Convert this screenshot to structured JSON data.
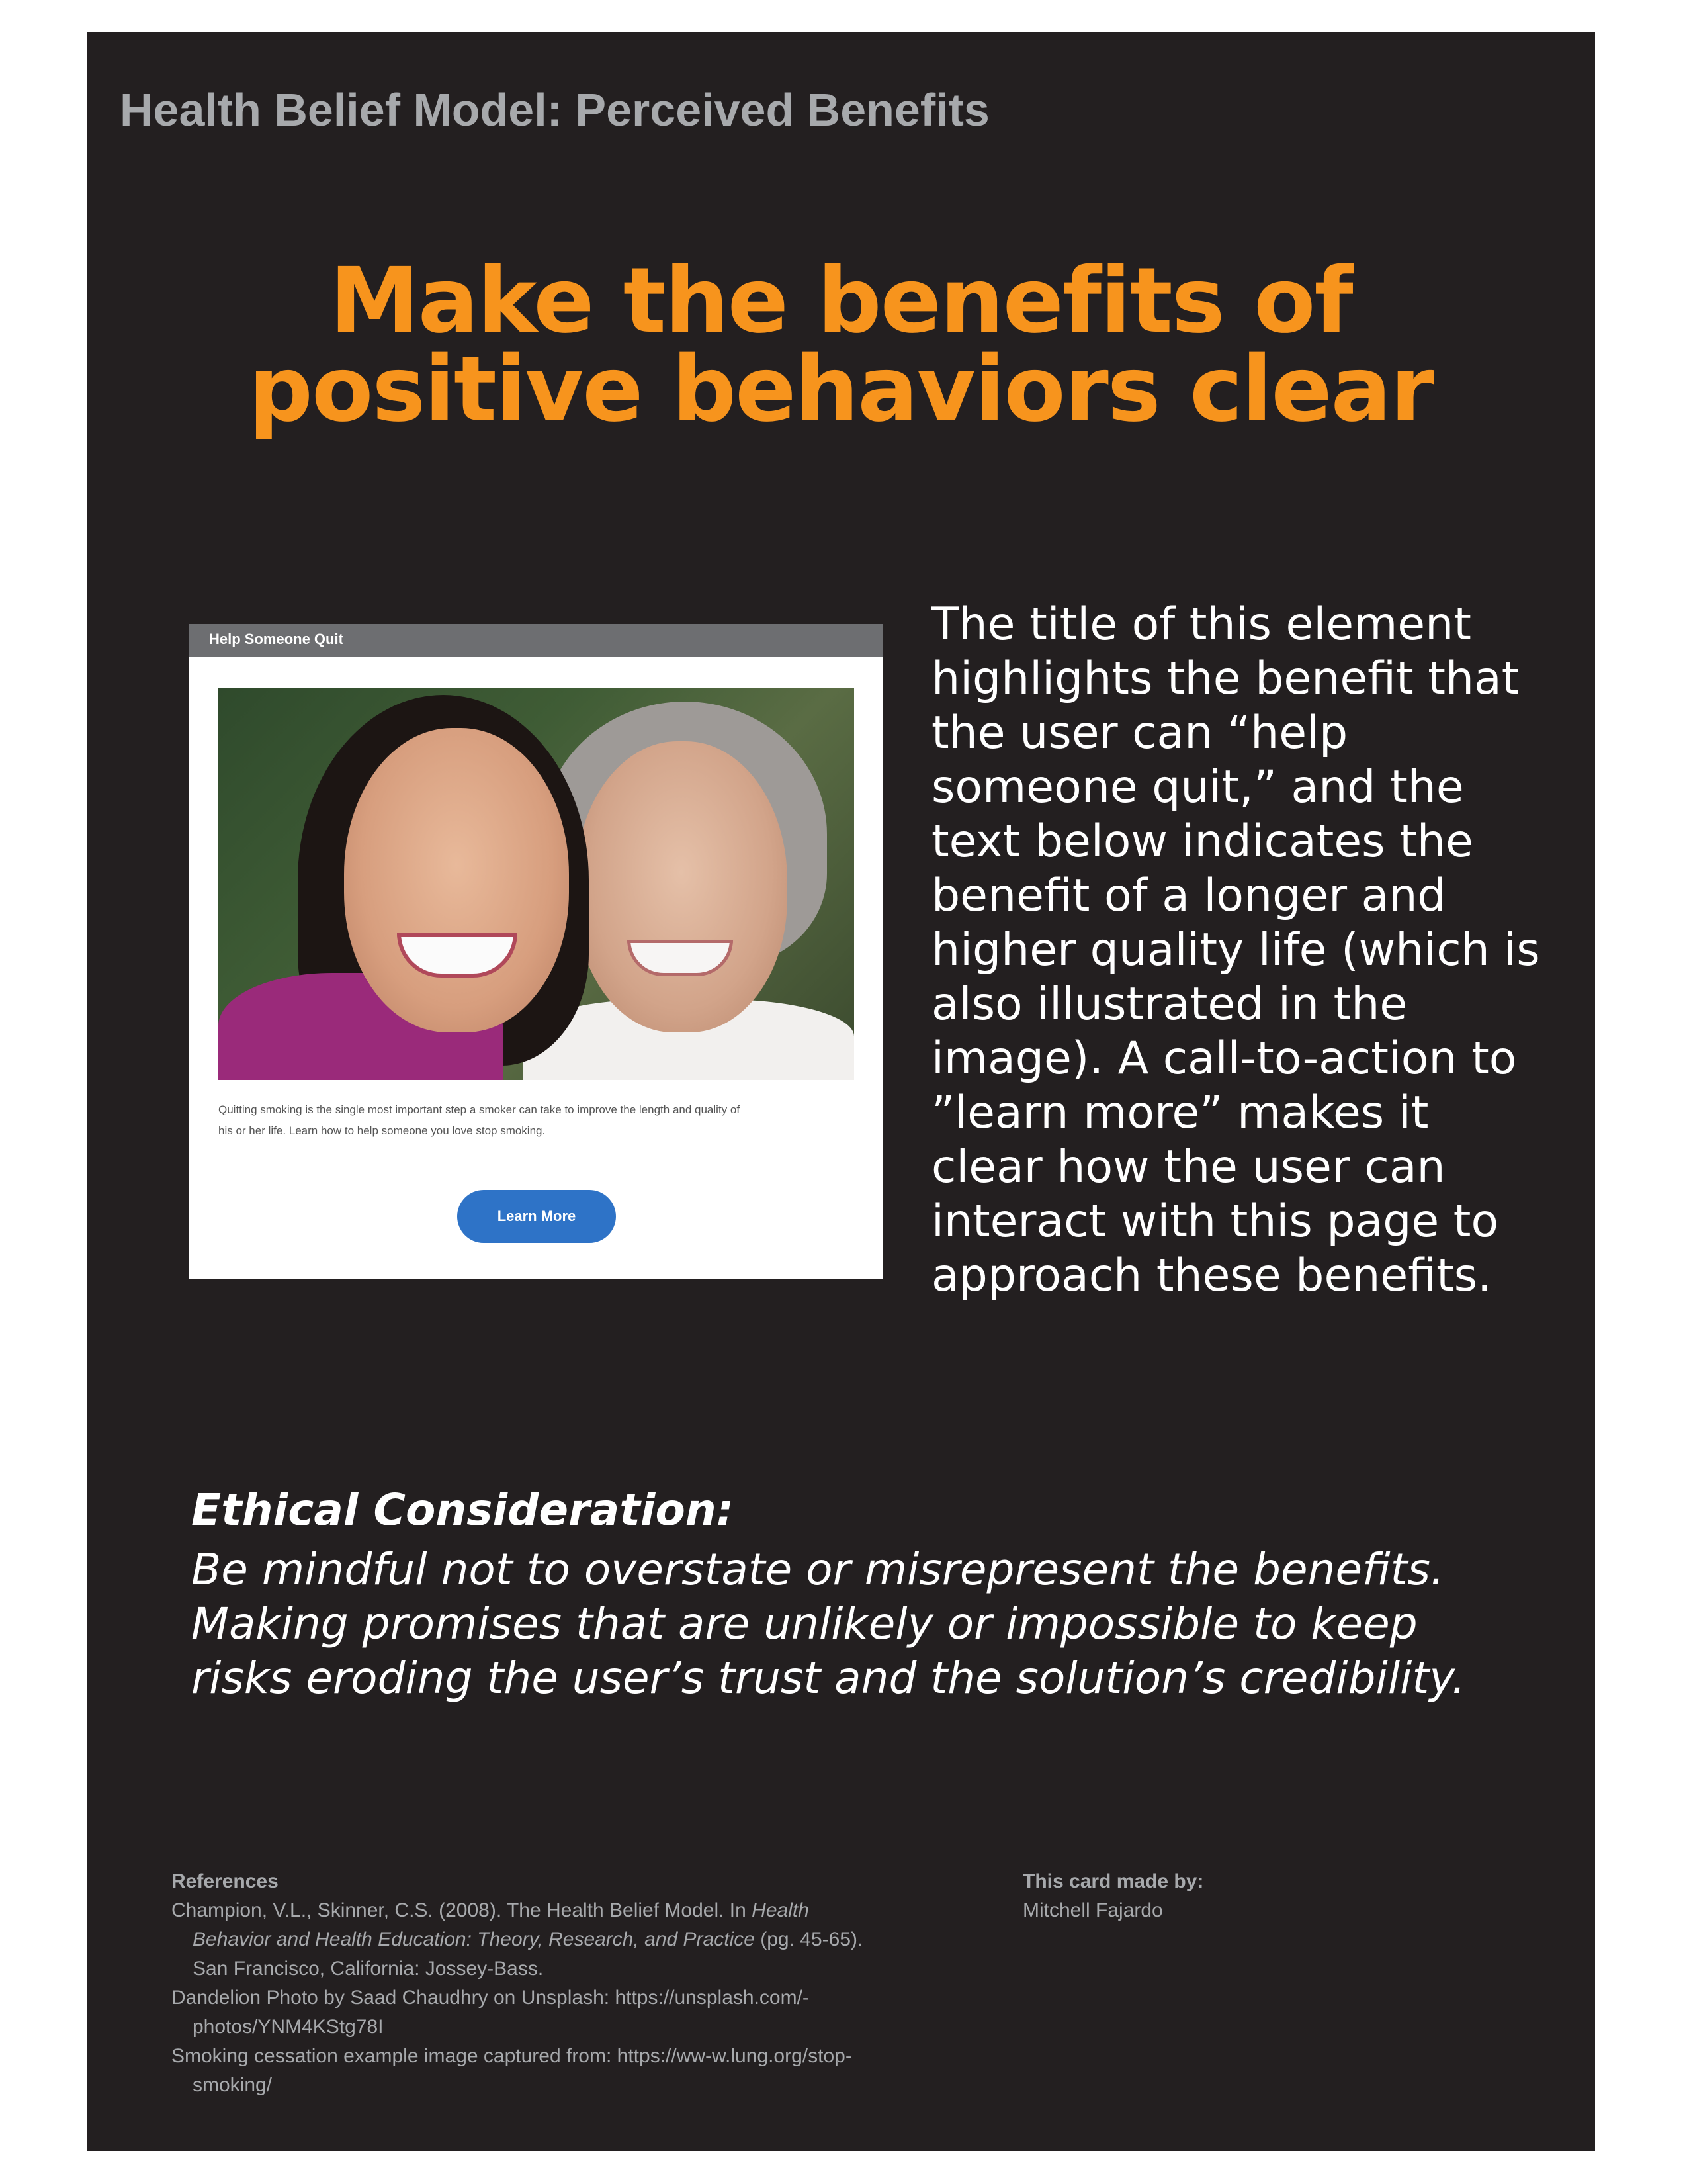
{
  "header": {
    "label": "Health Belief Model: Perceived Benefits"
  },
  "headline": {
    "line1": "Make the benefits of",
    "line2": "positive behaviors clear"
  },
  "example": {
    "bar_title": "Help Someone Quit",
    "caption_line1": "Quitting smoking is the single most important step a smoker can take to improve the length and quality of",
    "caption_line2": "his or her life. Learn how to help someone you love stop smoking.",
    "button_label": "Learn More"
  },
  "description": {
    "lines": [
      "The title of this element",
      "highlights the benefit that",
      "the user can “help",
      "someone quit,” and the",
      "text below indicates the",
      "benefit of a longer and",
      "higher quality life (which is",
      "also illustrated in the",
      "image). A call-to-action to",
      "”learn more” makes it",
      "clear how the user can",
      "interact with this page to",
      "approach these benefits."
    ]
  },
  "ethical": {
    "heading": "Ethical Consideration:",
    "lines": [
      "Be mindful not to overstate or misrepresent the benefits.",
      "Making promises that are unlikely or impossible to keep",
      "risks eroding the user’s trust and the solution’s credibility."
    ]
  },
  "references": {
    "title": "References",
    "ref1_prefix": "Champion, V.L., Skinner, C.S. (2008). The Health Belief Model. In ",
    "ref1_italic": "Health Behavior and Health Education: Theory, Research, and Practice",
    "ref1_suffix": " (pg. 45-65). San Francisco, California: Jossey-Bass.",
    "ref2": "Dandelion Photo by Saad Chaudhry on Unsplash: https://unsplash.com/-photos/YNM4KStg78I",
    "ref3": "Smoking cessation example image captured from: https://ww-w.lung.org/stop-smoking/"
  },
  "credit": {
    "title": "This card made by:",
    "name": "Mitchell Fajardo"
  },
  "colors": {
    "background": "#231f20",
    "accent": "#f7941d",
    "muted_text": "#a7a9ac",
    "button_blue": "#2e73c7"
  }
}
